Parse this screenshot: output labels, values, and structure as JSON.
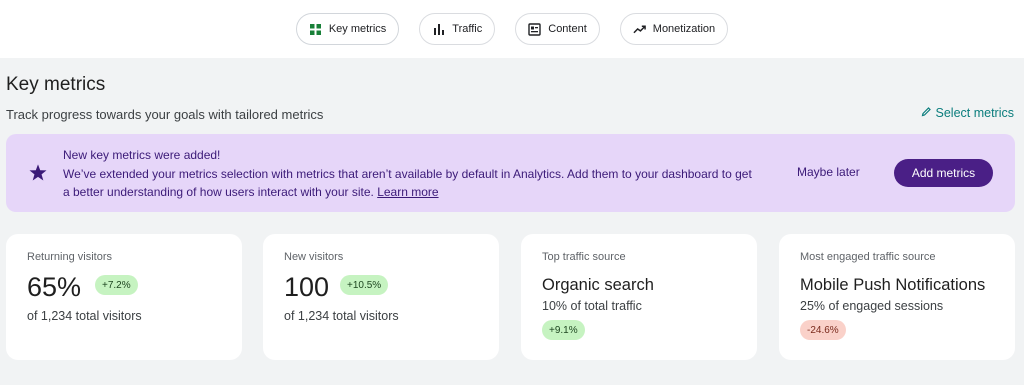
{
  "tabs": [
    {
      "label": "Key metrics",
      "icon": "grid-icon"
    },
    {
      "label": "Traffic",
      "icon": "bar-chart-icon"
    },
    {
      "label": "Content",
      "icon": "article-icon"
    },
    {
      "label": "Monetization",
      "icon": "trending-up-icon"
    }
  ],
  "header": {
    "title": "Key metrics",
    "subtitle": "Track progress towards your goals with tailored metrics",
    "select_metrics": "Select metrics"
  },
  "banner": {
    "title": "New key metrics were added!",
    "text": "We’ve extended your metrics selection with metrics that aren’t available by default in Analytics. Add them to your dashboard to get a better understanding of how users interact with your site.",
    "link": "Learn more",
    "maybe_later": "Maybe later",
    "add_metrics": "Add metrics"
  },
  "cards": [
    {
      "label": "Returning visitors",
      "value": "65%",
      "change": "+7.2%",
      "detail": "of 1,234 total visitors"
    },
    {
      "label": "New visitors",
      "value": "100",
      "change": "+10.5%",
      "detail": "of 1,234 total visitors"
    },
    {
      "label": "Top traffic source",
      "value": "Organic search",
      "detail": "10% of total traffic",
      "change": "+9.1%"
    },
    {
      "label": "Most engaged traffic source",
      "value": "Mobile Push Notifications",
      "detail": "25% of engaged sessions",
      "change": "-24.6%"
    }
  ],
  "colors": {
    "accent_purple": "#4a1f86",
    "banner_bg": "#e6d6f9",
    "link_teal": "#0b7d7d",
    "positive_badge": "#c6f3c1",
    "negative_badge": "#fad1c9",
    "grid_icon_green": "#188038"
  }
}
